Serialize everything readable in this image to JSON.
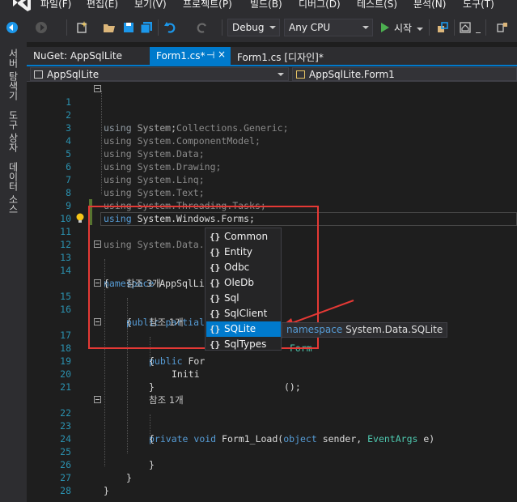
{
  "menubar": {
    "items": [
      "파일(F)",
      "편집(E)",
      "보기(V)",
      "프로젝트(P)",
      "빌드(B)",
      "디버그(D)",
      "테스트(S)",
      "분석(N)",
      "도구(T)"
    ]
  },
  "toolbar": {
    "config": "Debug",
    "platform": "Any CPU",
    "start_label": "시작",
    "icons": [
      "back-arrow-icon",
      "forward-arrow-icon",
      "new-project-icon",
      "open-folder-icon",
      "save-icon",
      "save-all-icon",
      "undo-icon",
      "redo-icon",
      "play-icon",
      "find-icon",
      "home-icon"
    ]
  },
  "sidebar": {
    "tabs": [
      "서버 탐색기",
      "도구 상자",
      "데이터 소스"
    ]
  },
  "tabs": [
    {
      "label": "NuGet: AppSqlLite",
      "active": false
    },
    {
      "label": "Form1.cs*",
      "active": true,
      "pin": "⊣",
      "close": "×"
    },
    {
      "label": "Form1.cs [디자인]*",
      "active": false
    }
  ],
  "navbar": {
    "project": "AppSqlLite",
    "class": "AppSqlLite.Form1"
  },
  "code": {
    "line_numbers": [
      "1",
      "2",
      "3",
      "4",
      "5",
      "6",
      "7",
      "8",
      "9",
      "10",
      "11",
      "12",
      "13",
      "14",
      "15",
      "16",
      "17",
      "18",
      "19",
      "20",
      "21",
      "22",
      "23",
      "24",
      "25",
      "26",
      "27",
      "28"
    ],
    "using_kw": "using",
    "usings": [
      "System;",
      "System.Collections.Generic;",
      "System.ComponentModel;",
      "System.Data;",
      "System.Drawing;",
      "System.Linq;",
      "System.Text;",
      "System.Threading.Tasks;",
      "System.Windows.Forms;"
    ],
    "line11_ns": "System.Data.",
    "namespace_kw": "namespace",
    "namespace_name": "AppSqlLi",
    "open_brace": "{",
    "close_brace": "}",
    "ref3": "참조 3개",
    "ref1a": "참조 1개",
    "ref1b": "참조 1개",
    "public_partial": "public partial",
    "colon": ":",
    "form_type": "Form",
    "public_kw": "public",
    "ctor_name": "For",
    "init_call": "Initi",
    "init_tail": "();",
    "private_kw": "private",
    "void_kw": "void",
    "method_name": "Form1_Load(",
    "object_kw": "object",
    "sender_part": "sender,",
    "event_args": "EventArgs",
    "e_part": "e)"
  },
  "intellisense": {
    "items": [
      "Common",
      "Entity",
      "Odbc",
      "OleDb",
      "Sql",
      "SqlClient",
      "SQLite",
      "SqlTypes"
    ],
    "selected_index": 6,
    "icon": "{}"
  },
  "tooltip": {
    "keyword": "namespace",
    "text": "System.Data.SQLite"
  },
  "colors": {
    "accent": "#007acc",
    "keyword": "#569cd6",
    "type": "#4ec9b0",
    "line_number": "#2b91af",
    "annotation": "#e53935"
  }
}
